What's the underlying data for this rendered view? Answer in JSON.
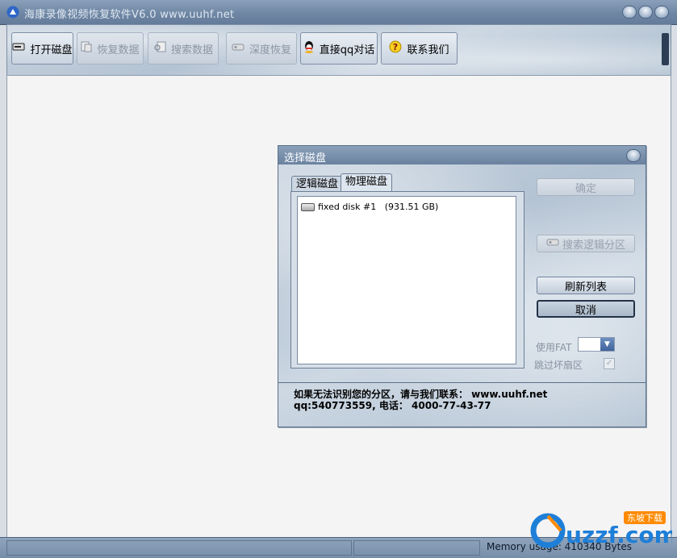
{
  "window": {
    "title": "海康录像视频恢复软件V6.0 www.uuhf.net"
  },
  "toolbar": {
    "buttons": [
      {
        "label": "打开磁盘",
        "icon": "disk-icon",
        "enabled": true
      },
      {
        "label": "恢复数据",
        "icon": "restore-icon",
        "enabled": false
      },
      {
        "label": "搜索数据",
        "icon": "search-icon",
        "enabled": false
      },
      {
        "label": "深度恢复",
        "icon": "deep-restore-icon",
        "enabled": false
      },
      {
        "label": "直接qq对话",
        "icon": "qq-icon",
        "enabled": true
      },
      {
        "label": "联系我们",
        "icon": "help-icon",
        "enabled": true
      }
    ]
  },
  "dialog": {
    "title": "选择磁盘",
    "tabs": [
      {
        "label": "逻辑磁盘",
        "active": false
      },
      {
        "label": "物理磁盘",
        "active": true
      }
    ],
    "disks": [
      {
        "label": "fixed disk #1   (931.51 GB)"
      }
    ],
    "buttons": {
      "ok": "确定",
      "search_partition": "搜索逻辑分区",
      "refresh": "刷新列表",
      "cancel": "取消"
    },
    "use_fat_label": "使用FAT",
    "fat_value": "",
    "skip_bad_label": "跳过坏扇区",
    "skip_bad_checked": true,
    "contact_line1": "如果无法识别您的分区，请与我们联系： www.uuhf.net",
    "contact_line2": "qq:540773559, 电话： 4000-77-43-77"
  },
  "statusbar": {
    "memory": "Memory usage: 410340 Bytes"
  },
  "watermark": {
    "text": "uzzf.com",
    "sub": "东坡下载"
  },
  "colors": {
    "titlebar": "#6f87a4",
    "accent": "#243247",
    "disabled_text": "#8c97a5"
  }
}
